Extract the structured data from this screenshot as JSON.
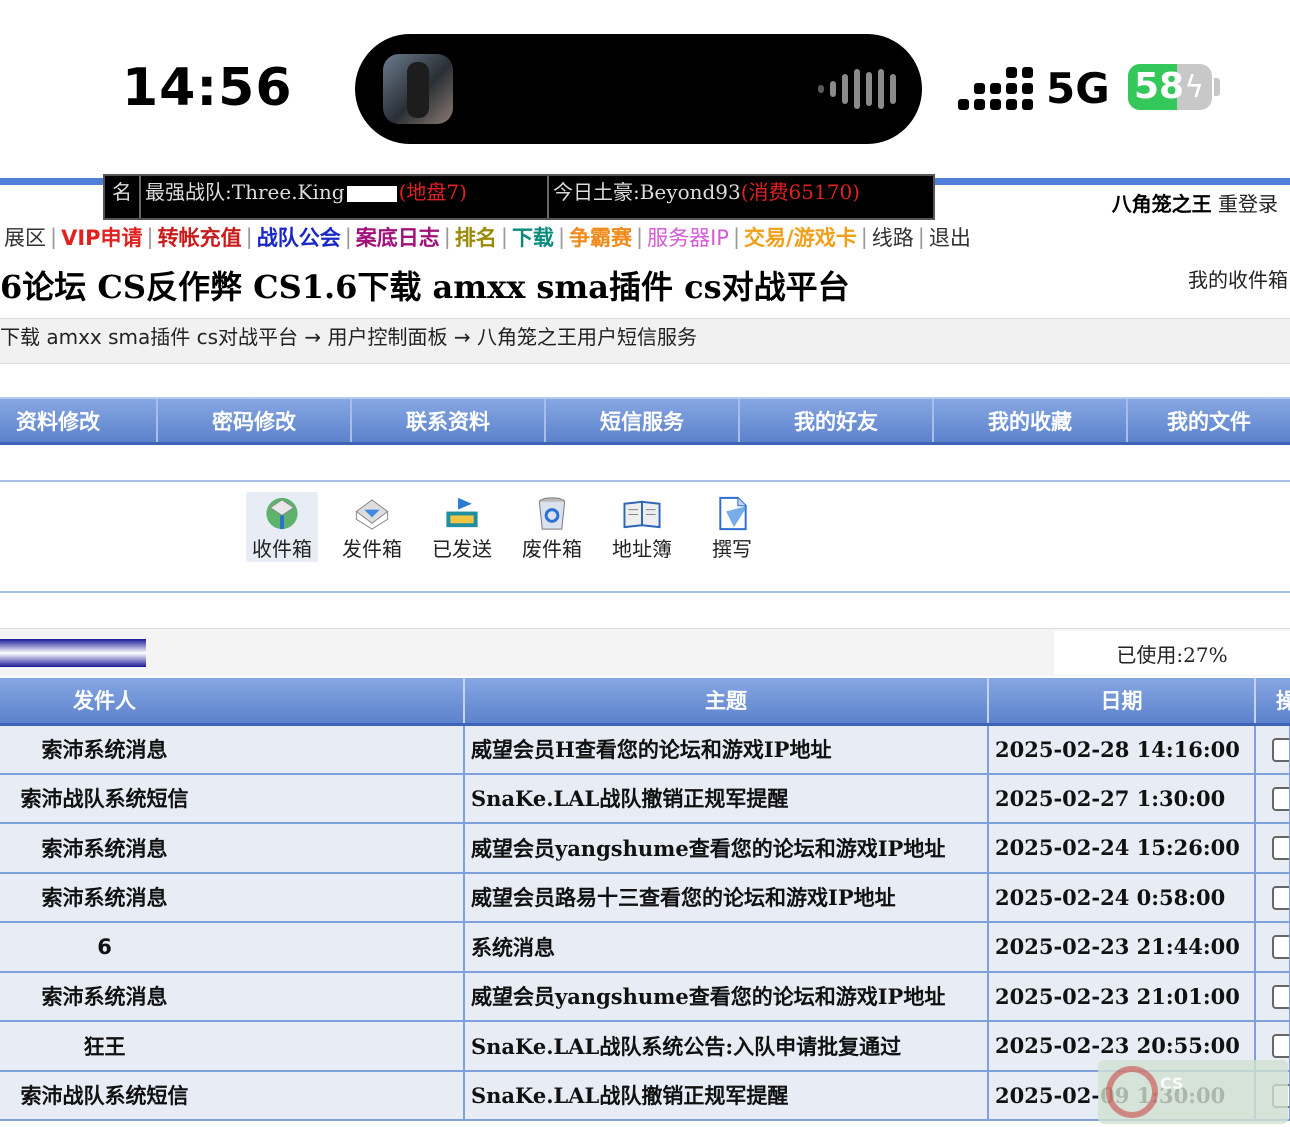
{
  "status_bar": {
    "time": "14:56",
    "network": "5G",
    "battery": "58",
    "battery_level": 0.58,
    "colors": {
      "battery_fill": "#34c759"
    }
  },
  "header": {
    "ticker": [
      {
        "label": "名",
        "text": "",
        "red": ""
      },
      {
        "label": "",
        "text": "最强战队:Three.King",
        "red": "(地盘7)"
      },
      {
        "label": "",
        "text": "今日土豪:Beyond93",
        "red": "(消费65170)"
      }
    ],
    "username": "八角笼之王",
    "relogin": "重登录"
  },
  "nav": {
    "items": [
      {
        "label": "展区",
        "color": "#333333",
        "bold": false
      },
      {
        "label": "VIP申请",
        "color": "#e0211f",
        "bold": true
      },
      {
        "label": "转帐充值",
        "color": "#c81c1c",
        "bold": true
      },
      {
        "label": "战队公会",
        "color": "#1a27c7",
        "bold": true
      },
      {
        "label": "案底日志",
        "color": "#a0127a",
        "bold": true
      },
      {
        "label": "排名",
        "color": "#9a8a0a",
        "bold": true
      },
      {
        "label": "下载",
        "color": "#0a8a7a",
        "bold": true
      },
      {
        "label": "争霸赛",
        "color": "#f08a1a",
        "bold": true
      },
      {
        "label": "服务器IP",
        "color": "#d65ad6",
        "bold": false
      },
      {
        "label": "交易/游戏卡",
        "color": "#f0a01a",
        "bold": true
      },
      {
        "label": "线路",
        "color": "#333333",
        "bold": false
      },
      {
        "label": "退出",
        "color": "#333333",
        "bold": false
      }
    ]
  },
  "site_title": "6论坛 CS反作弊 CS1.6下载 amxx sma插件 cs对战平台",
  "inbox_link": "我的收件箱",
  "breadcrumb": "下载 amxx sma插件 cs对战平台 → 用户控制面板 → 八角笼之王用户短信服务",
  "tabs": [
    "资料修改",
    "密码修改",
    "联系资料",
    "短信服务",
    "我的好友",
    "我的收藏",
    "我的文件"
  ],
  "mailbox": [
    {
      "label": "收件箱",
      "icon": "inbox-icon"
    },
    {
      "label": "发件箱",
      "icon": "outbox-icon"
    },
    {
      "label": "已发送",
      "icon": "sent-icon"
    },
    {
      "label": "废件箱",
      "icon": "trash-icon"
    },
    {
      "label": "地址簿",
      "icon": "address-book-icon"
    },
    {
      "label": "撰写",
      "icon": "compose-icon"
    }
  ],
  "usage": {
    "text": "已使用:27%",
    "percent": 27
  },
  "table": {
    "headers": [
      "发件人",
      "主题",
      "日期",
      "操作"
    ],
    "rows": [
      {
        "sender": "索沛系统消息",
        "subject": "威望会员H查看您的论坛和游戏IP地址",
        "date": "2025-02-28 14:16:00"
      },
      {
        "sender": "索沛战队系统短信",
        "subject": "SnaKe.LAL战队撤销正规军提醒",
        "date": "2025-02-27 1:30:00"
      },
      {
        "sender": "索沛系统消息",
        "subject": "威望会员yangshume查看您的论坛和游戏IP地址",
        "date": "2025-02-24 15:26:00"
      },
      {
        "sender": "索沛系统消息",
        "subject": "威望会员路易十三查看您的论坛和游戏IP地址",
        "date": "2025-02-24 0:58:00"
      },
      {
        "sender": "6",
        "subject": "系统消息",
        "date": "2025-02-23 21:44:00"
      },
      {
        "sender": "索沛系统消息",
        "subject": "威望会员yangshume查看您的论坛和游戏IP地址",
        "date": "2025-02-23 21:01:00"
      },
      {
        "sender": "狂王",
        "subject": "SnaKe.LAL战队系统公告:入队申请批复通过",
        "date": "2025-02-23 20:55:00"
      },
      {
        "sender": "索沛战队系统短信",
        "subject": "SnaKe.LAL战队撤销正规军提醒",
        "date": "2025-02-09 1:30:00"
      }
    ]
  }
}
